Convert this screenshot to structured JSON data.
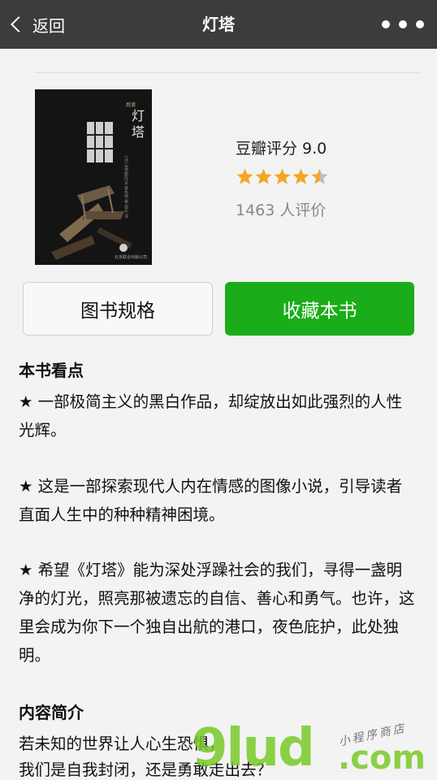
{
  "navbar": {
    "back_label": "返回",
    "title": "灯塔"
  },
  "book": {
    "cover": {
      "title": "灯塔",
      "publisher_tag": "后浪",
      "author_line": "[法] 克里斯托夫·夏布特 著 周乐 译",
      "publisher": "北京联合出版公司"
    },
    "score_text": "豆瓣评分 9.0",
    "stars": 4.5,
    "votes_text": "1463 人评价",
    "colors": {
      "star": "#f5a623",
      "star_empty": "#bdbdbd"
    }
  },
  "buttons": {
    "spec": "图书规格",
    "favorite": "收藏本书",
    "favorite_color": "#1aad19"
  },
  "highlights": {
    "title": "本书看点",
    "items": [
      "★ 一部极简主义的黑白作品，却绽放出如此强烈的人性光辉。",
      "★ 这是一部探索现代人内在情感的图像小说，引导读者直面人生中的种种精神困境。",
      "★ 希望《灯塔》能为深处浮躁社会的我们，寻得一盏明净的灯光，照亮那被遗忘的自信、善心和勇气。也许，这里会成为你下一个独自出航的港口，夜色庇护，此处独明。"
    ]
  },
  "intro": {
    "title": "内容简介",
    "lines": [
      "若未知的世界让人心生恐惧，",
      "我们是自我封闭，还是勇敢走出去？"
    ]
  },
  "watermark": {
    "brand": "9lud",
    "suffix": ".com",
    "tagline": "小程序商店"
  }
}
